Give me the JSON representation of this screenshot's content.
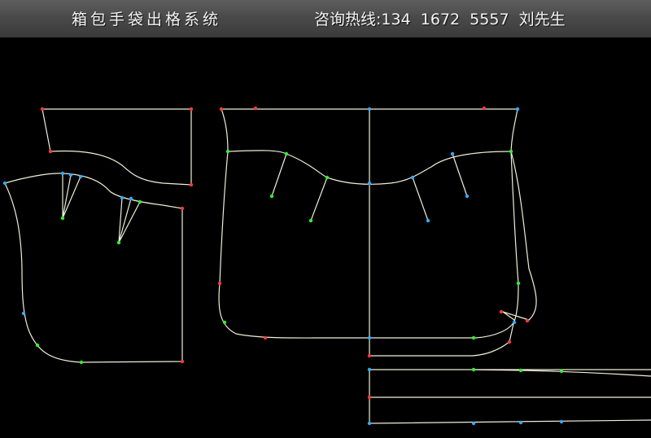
{
  "banner": {
    "title": "箱包手袋出格系统",
    "contact": "咨询热线:134  1672  5557  刘先生"
  },
  "colors": {
    "line": "#efefd8",
    "point_red": "#ff3a3a",
    "point_green": "#33ee33",
    "point_blue": "#33aaff",
    "background": "#000000",
    "banner": "#4a4a4a"
  }
}
